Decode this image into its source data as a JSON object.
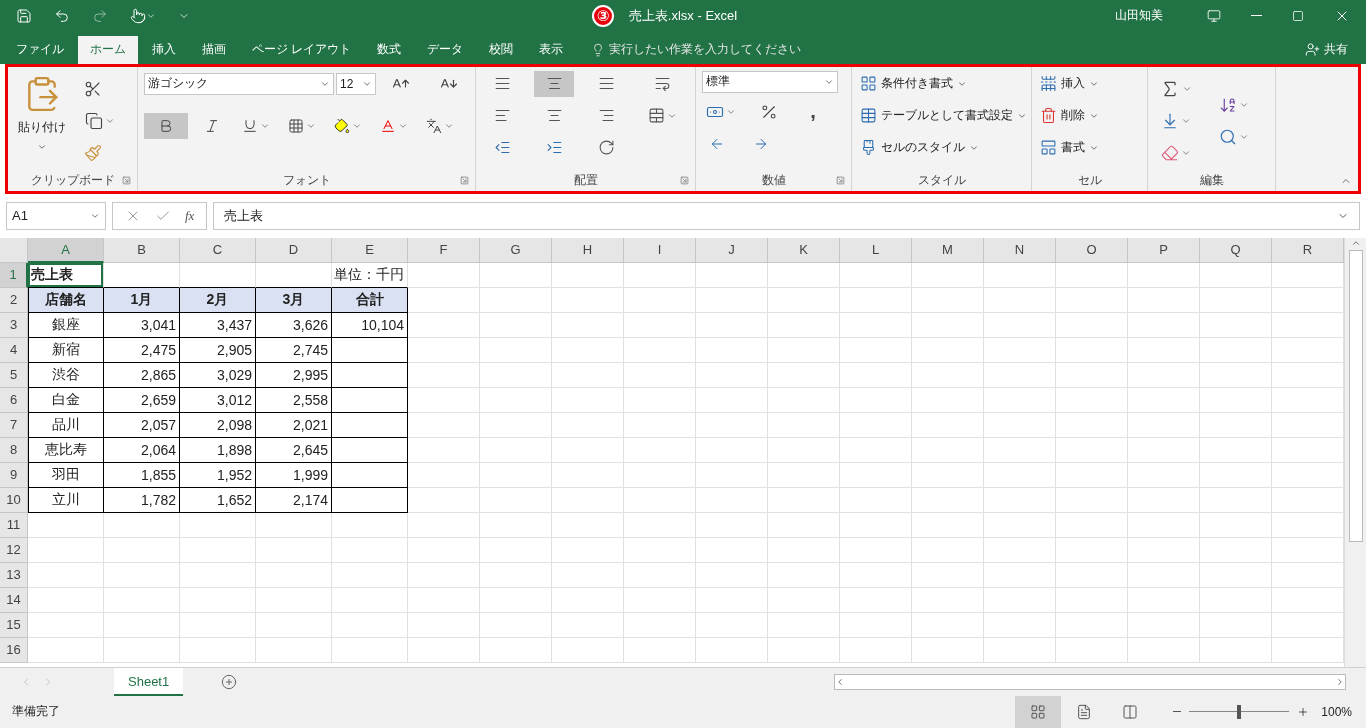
{
  "title_bar": {
    "title": "売上表.xlsx - Excel",
    "user": "山田知美"
  },
  "annotation_badge": "③",
  "tabs": [
    {
      "label": "ファイル",
      "selected": false
    },
    {
      "label": "ホーム",
      "selected": true
    },
    {
      "label": "挿入",
      "selected": false
    },
    {
      "label": "描画",
      "selected": false
    },
    {
      "label": "ページ レイアウト",
      "selected": false
    },
    {
      "label": "数式",
      "selected": false
    },
    {
      "label": "データ",
      "selected": false
    },
    {
      "label": "校閲",
      "selected": false
    },
    {
      "label": "表示",
      "selected": false
    }
  ],
  "tell_me": {
    "placeholder": "実行したい作業を入力してください"
  },
  "share": "共有",
  "ribbon": {
    "groups": [
      {
        "kind": "clipboard",
        "label": "クリップボード",
        "paste_label": "貼り付け"
      },
      {
        "kind": "font",
        "label": "フォント",
        "font_name": "游ゴシック",
        "font_size": "12",
        "bold": true
      },
      {
        "kind": "alignment",
        "label": "配置",
        "middle_align": true
      },
      {
        "kind": "number",
        "label": "数値",
        "format": "標準",
        "comma_symbol": ","
      },
      {
        "kind": "styles",
        "label": "スタイル",
        "items": [
          "条件付き書式",
          "テーブルとして書式設定",
          "セルのスタイル"
        ]
      },
      {
        "kind": "cells",
        "label": "セル",
        "items": [
          "挿入",
          "削除",
          "書式"
        ]
      },
      {
        "kind": "editing",
        "label": "編集"
      }
    ]
  },
  "formula_bar": {
    "name_box": "A1",
    "function_symbol": "fx",
    "formula": "売上表"
  },
  "sheet": {
    "columns": [
      {
        "label": "A",
        "selected": true
      },
      {
        "label": "B",
        "selected": false
      },
      {
        "label": "C",
        "selected": false
      },
      {
        "label": "D",
        "selected": false
      },
      {
        "label": "E",
        "selected": false
      },
      {
        "label": "F",
        "selected": false
      },
      {
        "label": "G",
        "selected": false
      },
      {
        "label": "H",
        "selected": false
      },
      {
        "label": "I",
        "selected": false
      },
      {
        "label": "J",
        "selected": false
      },
      {
        "label": "K",
        "selected": false
      },
      {
        "label": "L",
        "selected": false
      },
      {
        "label": "M",
        "selected": false
      },
      {
        "label": "N",
        "selected": false
      },
      {
        "label": "O",
        "selected": false
      },
      {
        "label": "P",
        "selected": false
      },
      {
        "label": "Q",
        "selected": false
      },
      {
        "label": "R",
        "selected": false
      }
    ],
    "rows": [
      {
        "label": "1",
        "selected": true
      },
      {
        "label": "2",
        "selected": false
      },
      {
        "label": "3",
        "selected": false
      },
      {
        "label": "4",
        "selected": false
      },
      {
        "label": "5",
        "selected": false
      },
      {
        "label": "6",
        "selected": false
      },
      {
        "label": "7",
        "selected": false
      },
      {
        "label": "8",
        "selected": false
      },
      {
        "label": "9",
        "selected": false
      },
      {
        "label": "10",
        "selected": false
      },
      {
        "label": "11",
        "selected": false
      },
      {
        "label": "12",
        "selected": false
      },
      {
        "label": "13",
        "selected": false
      },
      {
        "label": "14",
        "selected": false
      },
      {
        "label": "15",
        "selected": false
      },
      {
        "label": "16",
        "selected": false
      }
    ],
    "table": {
      "title": "売上表",
      "unit": "単位：千円",
      "header": [
        "店舗名",
        "1月",
        "2月",
        "3月",
        "合計"
      ],
      "rows": [
        {
          "store": "銀座",
          "values": [
            "3,041",
            "3,437",
            "3,626",
            "10,104"
          ]
        },
        {
          "store": "新宿",
          "values": [
            "2,475",
            "2,905",
            "2,745"
          ]
        },
        {
          "store": "渋谷",
          "values": [
            "2,865",
            "3,029",
            "2,995"
          ]
        },
        {
          "store": "白金",
          "values": [
            "2,659",
            "3,012",
            "2,558"
          ]
        },
        {
          "store": "品川",
          "values": [
            "2,057",
            "2,098",
            "2,021"
          ]
        },
        {
          "store": "恵比寿",
          "values": [
            "2,064",
            "1,898",
            "2,645"
          ]
        },
        {
          "store": "羽田",
          "values": [
            "1,855",
            "1,952",
            "1,999"
          ]
        },
        {
          "store": "立川",
          "values": [
            "1,782",
            "1,652",
            "2,174"
          ]
        }
      ]
    }
  },
  "sheet_tabs": [
    {
      "label": "Sheet1",
      "selected": true
    }
  ],
  "status_bar": {
    "status": "準備完了",
    "views": [
      {
        "kind": "normal",
        "selected": true
      },
      {
        "kind": "page_layout",
        "selected": false
      },
      {
        "kind": "page_break",
        "selected": false
      }
    ],
    "zoom": {
      "level": 0.5,
      "reading": "100%"
    }
  }
}
